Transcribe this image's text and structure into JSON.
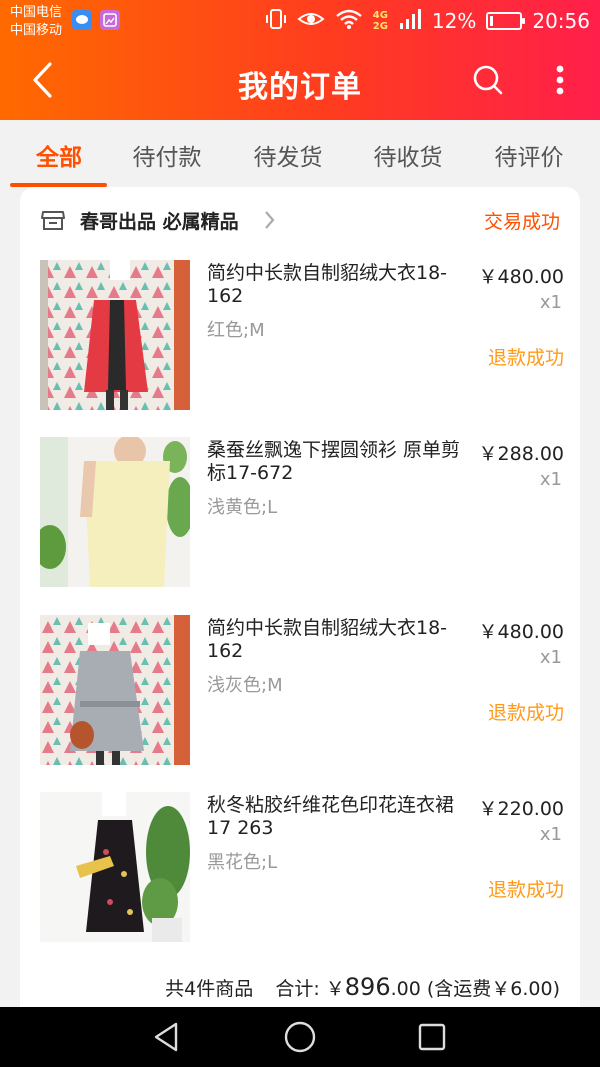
{
  "status_bar": {
    "carrier1": "中国电信",
    "carrier2": "中国移动",
    "net_tag_top": "4G",
    "net_tag_bottom": "2G",
    "net_tag_right": "2G",
    "battery": "12%",
    "battery_level": 0.12,
    "time": "20:56"
  },
  "header": {
    "title": "我的订单"
  },
  "tabs": [
    {
      "label": "全部",
      "active": true
    },
    {
      "label": "待付款"
    },
    {
      "label": "待发货"
    },
    {
      "label": "待收货"
    },
    {
      "label": "待评价"
    }
  ],
  "order": {
    "shop_name": "春哥出品 必属精品",
    "status": "交易成功",
    "items": [
      {
        "title": "简约中长款自制貂绒大衣18-162",
        "sku": "红色;M",
        "price": "￥480.00",
        "qty": "x1",
        "refund": "退款成功"
      },
      {
        "title": "桑蚕丝飘逸下摆圆领衫 原单剪标17-672",
        "sku": "浅黄色;L",
        "price": "￥288.00",
        "qty": "x1",
        "refund": ""
      },
      {
        "title": "简约中长款自制貂绒大衣18-162",
        "sku": "浅灰色;M",
        "price": "￥480.00",
        "qty": "x1",
        "refund": "退款成功"
      },
      {
        "title": "秋冬粘胶纤维花色印花连衣裙 17 263",
        "sku": "黑花色;L",
        "price": "￥220.00",
        "qty": "x1",
        "refund": "退款成功"
      }
    ],
    "summary": {
      "count_text": "共4件商品",
      "total_label": "合计:",
      "currency": "￥",
      "total_int": "896",
      "total_dec": ".00",
      "shipping": "(含运费￥6.00)"
    }
  },
  "colors": {
    "accent": "#ff5000",
    "refund": "#ff9a1a",
    "header_start": "#ff6a00",
    "header_end": "#ff1f4a"
  }
}
